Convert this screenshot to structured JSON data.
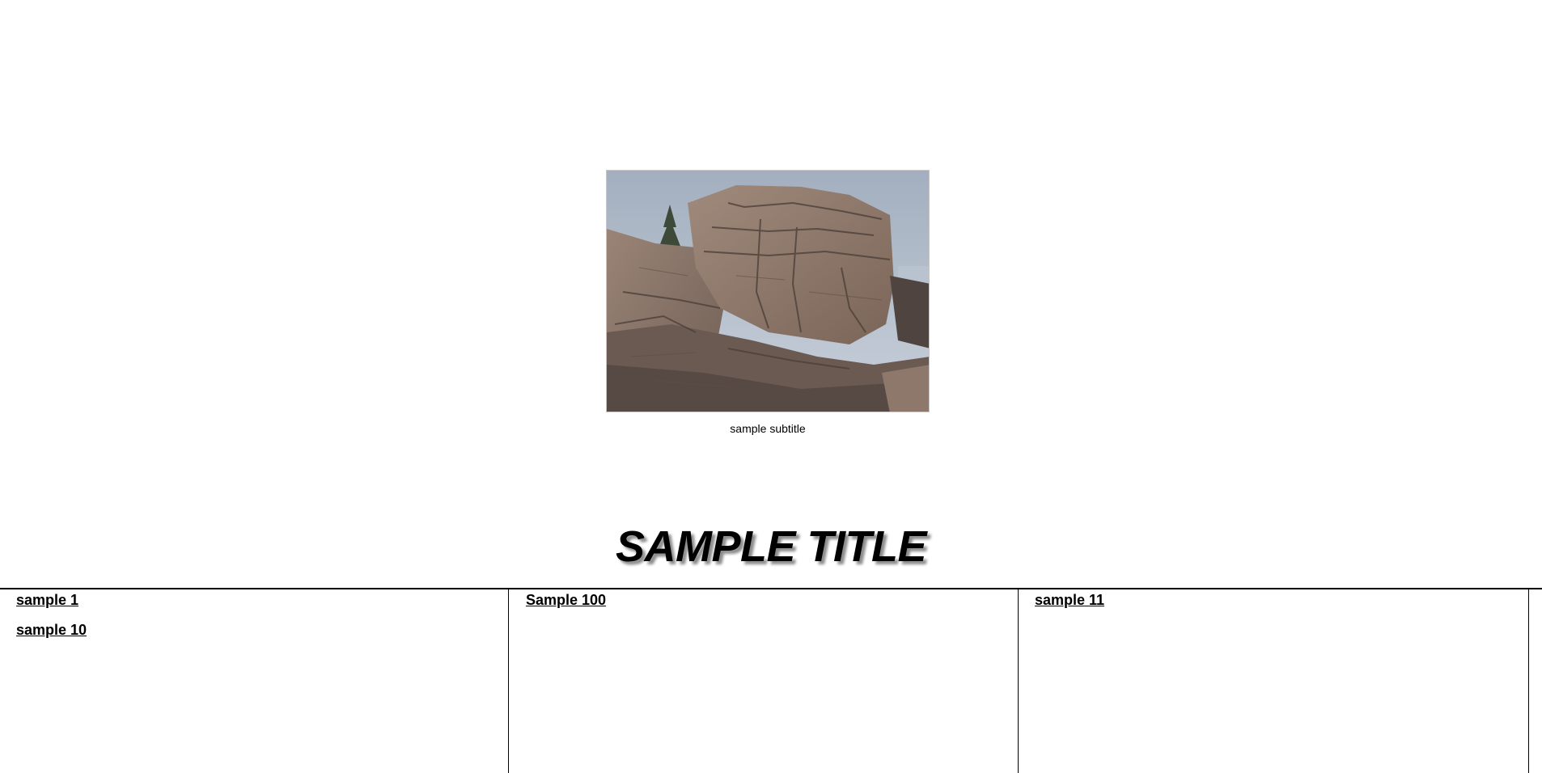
{
  "hero": {
    "image_alt": "rocky cliff",
    "caption": "sample subtitle"
  },
  "page_title": "SAMPLE TITLE",
  "columns": [
    {
      "links": [
        "sample 1",
        "sample 10"
      ]
    },
    {
      "links": [
        "Sample 100"
      ]
    },
    {
      "links": [
        "sample 11"
      ]
    }
  ],
  "colors": {
    "background": "#ffffff",
    "text": "#000000",
    "sky": "#aeb8c6",
    "rock": "#8a7669"
  }
}
